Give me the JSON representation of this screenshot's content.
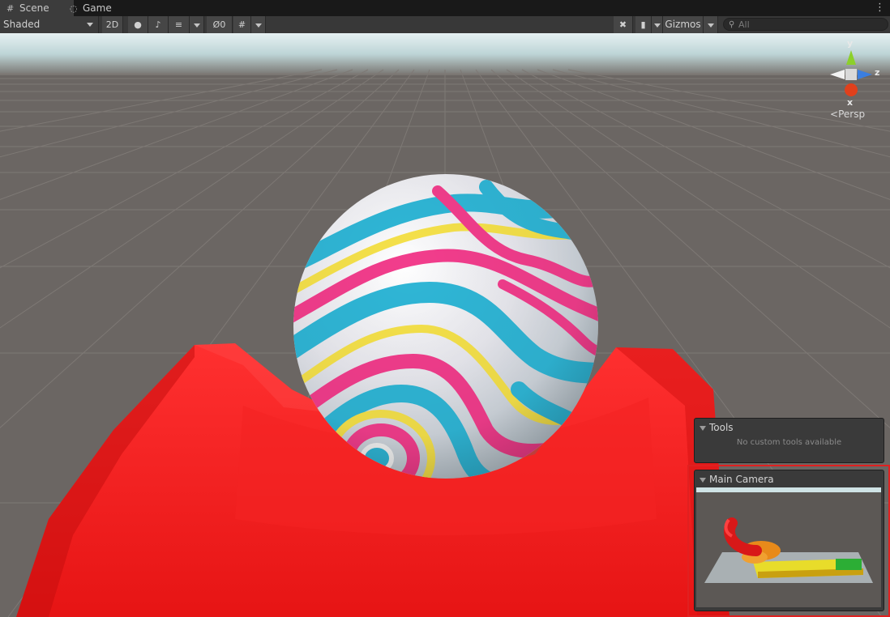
{
  "tabs": [
    {
      "label": "Scene",
      "icon": "grid-icon",
      "active": true
    },
    {
      "label": "Game",
      "icon": "gamepad-icon",
      "active": false
    }
  ],
  "toolbar": {
    "shading_mode": "Shaded",
    "mode_2d": "2D",
    "hidden_count": "0",
    "gizmos_label": "Gizmos",
    "search_placeholder": "All"
  },
  "scene_gizmo": {
    "axis_y": "y",
    "axis_z": "z",
    "axis_x": "x",
    "projection": "Persp",
    "colors": {
      "y": "#8cd02a",
      "z": "#3a7ee0",
      "x": "#e0401c"
    }
  },
  "tools_panel": {
    "title": "Tools",
    "message": "No custom tools available"
  },
  "camera_panel": {
    "title": "Main Camera"
  },
  "colors": {
    "ground": "#6b6663",
    "grid_line": "#7d7874",
    "horizon": "#cfe3e5",
    "ramp": "#f11b1b",
    "ball_pink": "#f23d8c",
    "ball_cyan": "#2fb6d6",
    "ball_yellow": "#f5e14a",
    "camera_outline": "#e02020"
  }
}
